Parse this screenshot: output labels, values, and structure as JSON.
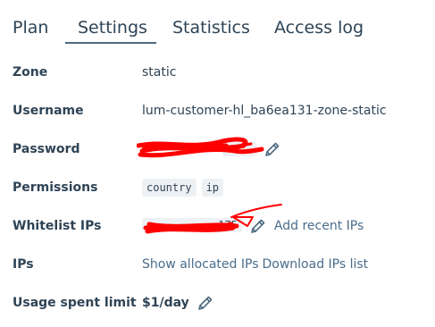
{
  "tabs": {
    "plan": "Plan",
    "settings": "Settings",
    "statistics": "Statistics",
    "access_log": "Access log",
    "active": "Settings"
  },
  "rows": {
    "zone": {
      "label": "Zone",
      "value": "static"
    },
    "username": {
      "label": "Username",
      "value": "lum-customer-hl_ba6ea131-zone-static"
    },
    "password": {
      "label": "Password"
    },
    "permissions": {
      "label": "Permissions",
      "values": [
        "country",
        "ip"
      ]
    },
    "whitelist": {
      "label": "Whitelist IPs",
      "ip_tail": ".175",
      "link": "Add recent IPs"
    },
    "ips": {
      "label": "IPs",
      "show_link": "Show allocated IPs",
      "download_link": "Download IPs list"
    },
    "usage": {
      "label": "Usage spent limit",
      "value": "$1/day"
    }
  },
  "colors": {
    "text": "#2f4456",
    "link": "#4a6d8c",
    "chip_bg": "#eef1f4",
    "redaction": "#ff0000"
  },
  "icons": {
    "edit": "pencil-icon"
  }
}
